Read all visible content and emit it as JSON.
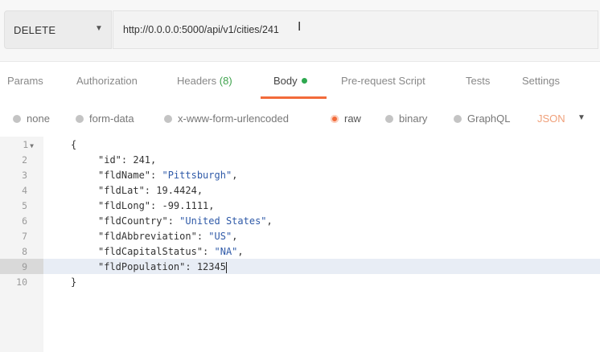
{
  "request": {
    "method": "DELETE",
    "url": "http://0.0.0.0:5000/api/v1/cities/241"
  },
  "tabs": [
    {
      "label": "Params"
    },
    {
      "label": "Authorization"
    },
    {
      "label": "Headers",
      "count": "(8)"
    },
    {
      "label": "Body"
    },
    {
      "label": "Pre-request Script"
    },
    {
      "label": "Tests"
    },
    {
      "label": "Settings"
    }
  ],
  "body_types": [
    "none",
    "form-data",
    "x-www-form-urlencoded",
    "raw",
    "binary",
    "GraphQL"
  ],
  "format": "JSON",
  "editor": {
    "line_numbers": [
      "1",
      "2",
      "3",
      "4",
      "5",
      "6",
      "7",
      "8",
      "9",
      "10"
    ],
    "lines": [
      {
        "open": "{"
      },
      {
        "key": "\"id\"",
        "value": "241",
        "comma": ","
      },
      {
        "key": "\"fldName\"",
        "value": "\"Pittsburgh\"",
        "comma": ","
      },
      {
        "key": "\"fldLat\"",
        "value": "19.4424",
        "comma": ","
      },
      {
        "key": "\"fldLong\"",
        "value": "-99.1111",
        "comma": ","
      },
      {
        "key": "\"fldCountry\"",
        "value": "\"United States\"",
        "comma": ","
      },
      {
        "key": "\"fldAbbreviation\"",
        "value": "\"US\"",
        "comma": ","
      },
      {
        "key": "\"fldCapitalStatus\"",
        "value": "\"NA\"",
        "comma": ","
      },
      {
        "key": "\"fldPopulation\"",
        "value": "12345",
        "comma": ""
      },
      {
        "close": "}"
      }
    ]
  },
  "colors": {
    "accent": "#f26b3a",
    "active_dot": "#2ea84f",
    "string": "#2f5aa8"
  }
}
